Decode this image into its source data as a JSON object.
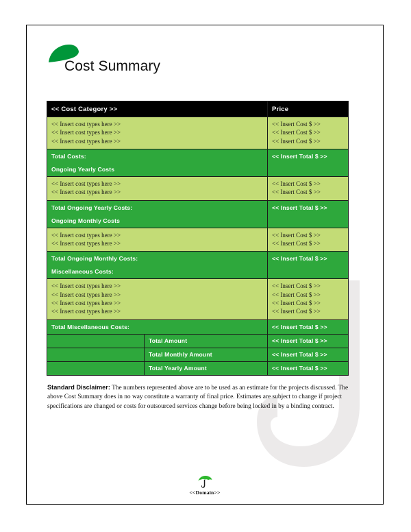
{
  "document": {
    "title": "Cost Summary",
    "logo_icon": "green-arc-umbrella-canopy-icon",
    "watermark_icon": "umbrella-handle-watermark-icon",
    "colors": {
      "dark_green": "#2ea83c",
      "light_green": "#c3dc76",
      "header_black": "#000000",
      "watermark_gray": "#eceaea"
    }
  },
  "table": {
    "header": {
      "category": "<< Cost Category >>",
      "price": "Price"
    },
    "sections": [
      {
        "items": [
          {
            "label": "<< Insert cost types here >>",
            "price": "<< Insert Cost $ >>"
          },
          {
            "label": "<< Insert cost types here >>",
            "price": "<< Insert Cost $ >>"
          },
          {
            "label": "<< Insert cost types here >>",
            "price": "<< Insert Cost $ >>"
          }
        ],
        "total_label": "Total Costs:",
        "next_heading": "Ongoing Yearly Costs",
        "total_value": "<< Insert Total $ >>"
      },
      {
        "items": [
          {
            "label": "<< Insert cost types here >>",
            "price": "<< Insert Cost $ >>"
          },
          {
            "label": "<< Insert cost types here >>",
            "price": "<< Insert Cost $ >>"
          }
        ],
        "total_label": "Total Ongoing Yearly Costs:",
        "next_heading": "Ongoing Monthly Costs",
        "total_value": "<< Insert Total $ >>"
      },
      {
        "items": [
          {
            "label": "<< Insert cost types here >>",
            "price": "<< Insert Cost $ >>"
          },
          {
            "label": "<< Insert cost types here >>",
            "price": "<< Insert Cost $ >>"
          }
        ],
        "total_label": "Total Ongoing Monthly Costs:",
        "next_heading": "Miscellaneous Costs:",
        "total_value": "<< Insert Total $ >>"
      },
      {
        "items": [
          {
            "label": "<< Insert cost types here >>",
            "price": "<< Insert Cost $ >>"
          },
          {
            "label": "<< Insert cost types here >>",
            "price": "<< Insert Cost $ >>"
          },
          {
            "label": "<< Insert cost types here >>",
            "price": "<< Insert Cost $ >>"
          },
          {
            "label": "<< Insert cost types here >>",
            "price": "<< Insert Cost $ >>"
          }
        ],
        "total_label": "Total Miscellaneous Costs:",
        "next_heading": "",
        "total_value": "<< Insert Total $ >>"
      }
    ],
    "summary_rows": [
      {
        "label": "Total Amount",
        "value": "<< Insert Total $ >>"
      },
      {
        "label": "Total Monthly Amount",
        "value": "<< Insert Total $ >>"
      },
      {
        "label": "Total Yearly Amount",
        "value": "<< Insert Total $ >>"
      }
    ]
  },
  "disclaimer": {
    "heading": "Standard Disclaimer:",
    "body": " The numbers represented above are to be used as an estimate for the projects discussed. The above Cost Summary does in no way constitute a warranty of final price.  Estimates are subject to change if project specifications are changed or costs for outsourced services change before being locked in by a binding contract."
  },
  "footer": {
    "text": "<<Domain>>",
    "icon": "umbrella-icon"
  }
}
